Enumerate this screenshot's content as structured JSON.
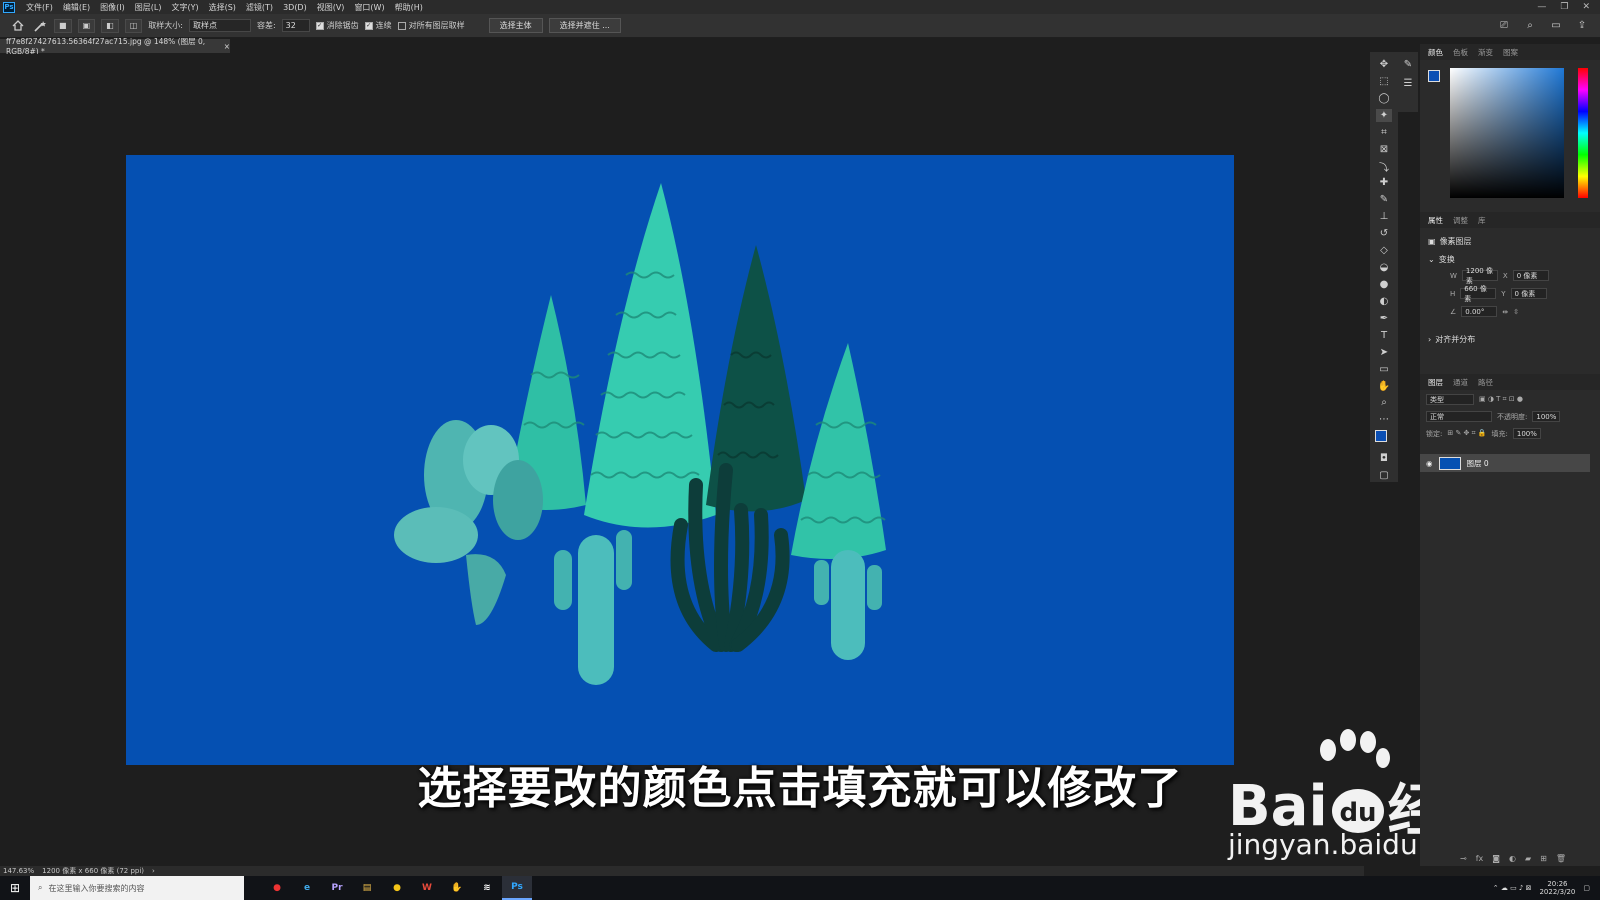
{
  "menubar": {
    "logo": "Ps",
    "items": [
      "文件(F)",
      "编辑(E)",
      "图像(I)",
      "图层(L)",
      "文字(Y)",
      "选择(S)",
      "滤镜(T)",
      "3D(D)",
      "视图(V)",
      "窗口(W)",
      "帮助(H)"
    ],
    "window_controls": [
      "—",
      "❐",
      "✕"
    ]
  },
  "options": {
    "sample_size_label": "取样大小:",
    "sample_size_value": "取样点",
    "tolerance_label": "容差:",
    "tolerance_value": "32",
    "antialias_label": "消除锯齿",
    "contiguous_label": "连续",
    "all_layers_label": "对所有图层取样",
    "select_subject": "选择主体",
    "select_mask": "选择并遮住 ..."
  },
  "document": {
    "tab_title": "ff7e8f27427613.56364f27ac715.jpg @ 148% (图层 0, RGB/8#) *",
    "tab_close": "×"
  },
  "subtitle": "选择要改的颜色点击填充就可以修改了",
  "watermark": {
    "brand_a": "Bai",
    "brand_b": "经验",
    "url": "jingyan.baidu.com"
  },
  "status": {
    "zoom": "147.63%",
    "doc_info": "1200 像素 x 660 像素 (72 ppi)",
    "arrow": "›"
  },
  "panels": {
    "color_tabs": [
      "颜色",
      "色板",
      "渐变",
      "图案"
    ],
    "props_tabs": [
      "属性",
      "调整",
      "库"
    ],
    "props_type": "像素图层",
    "transform_label": "变换",
    "w_label": "W",
    "w_value": "1200 像素",
    "x_label": "X",
    "x_value": "0 像素",
    "h_label": "H",
    "h_value": "660 像素",
    "y_label": "Y",
    "y_value": "0 像素",
    "angle_value": "0.00°",
    "align_label": "对齐并分布",
    "layers_tabs": [
      "图层",
      "通道",
      "路径"
    ],
    "kind_label": "类型",
    "blend_mode": "正常",
    "opacity_label": "不透明度:",
    "opacity_value": "100%",
    "lock_label": "锁定:",
    "fill_label": "填充:",
    "fill_value": "100%",
    "layer_name": "图层 0"
  },
  "taskbar": {
    "search_placeholder": "在这里输入你要搜索的内容",
    "apps": [
      "●",
      "e",
      "Pr",
      "▤",
      "●",
      "W",
      "✋",
      "≋",
      "Ps"
    ],
    "time": "20:26",
    "date": "2022/3/20"
  },
  "colors": {
    "canvas_blue": "#0550b2",
    "cactus_teal": "#33c7ac",
    "cactus_dark": "#0d5147",
    "foreground": "#0b4fb4"
  },
  "icons": [
    "home-icon",
    "magic-wand-icon",
    "move-icon",
    "marquee-icon",
    "lasso-icon",
    "crop-icon",
    "eyedropper-icon",
    "brush-icon",
    "stamp-icon",
    "eraser-icon",
    "bucket-icon",
    "pen-icon",
    "type-icon",
    "hand-icon",
    "zoom-icon",
    "eye-icon",
    "search-icon",
    "windows-icon"
  ]
}
